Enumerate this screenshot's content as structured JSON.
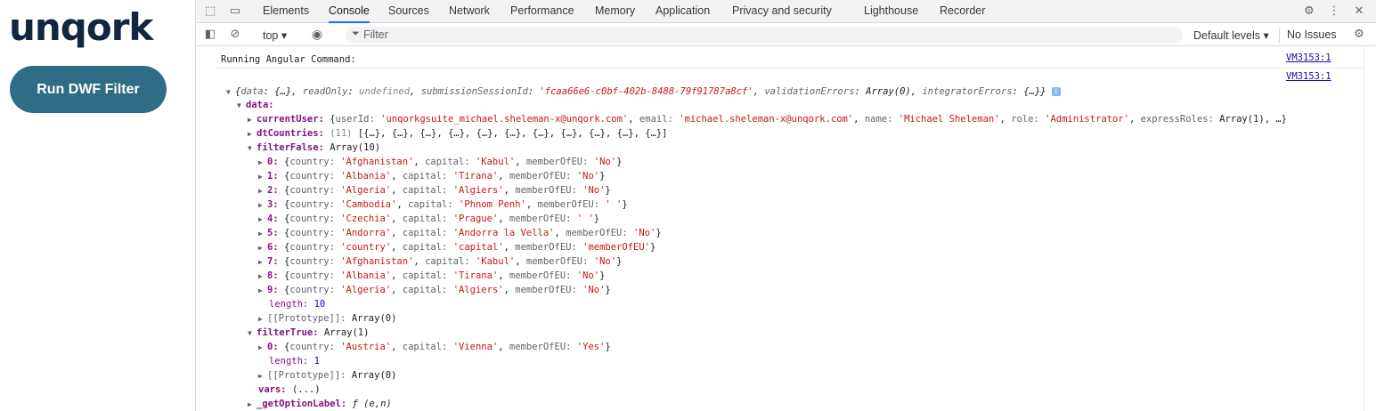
{
  "app": {
    "logo": "unqork",
    "run_button": "Run DWF Filter"
  },
  "devtools": {
    "tabs": [
      "Elements",
      "Console",
      "Sources",
      "Network",
      "Performance",
      "Memory",
      "Application",
      "Privacy and security",
      "Lighthouse",
      "Recorder"
    ],
    "active_tab": "Console",
    "context": "top ▾",
    "filter_placeholder": "Filter",
    "levels": "Default levels ▾",
    "issues": "No Issues"
  },
  "console": {
    "message": "Running Angular Command:",
    "source1": "VM3153:1",
    "source2": "VM3153:1",
    "summary": {
      "open": "{",
      "k1": "data",
      "v1": "{…}",
      "k2": "readOnly",
      "v2": "undefined",
      "k3": "submissionSessionId",
      "v3": "'fcaa66e6-c0bf-402b-8488-79f91787a8cf'",
      "k4": "validationErrors",
      "v4": "Array(0)",
      "k5": "integratorErrors",
      "v5": "{…}",
      "close": "}",
      "badge": "i"
    },
    "data_key": "data:",
    "current_user": {
      "key": "currentUser:",
      "prefix": "{",
      "userId_k": "userId:",
      "userId_v": "'unqorkgsuite_michael.sheleman-x@unqork.com'",
      "email_k": "email:",
      "email_v": "'michael.sheleman-x@unqork.com'",
      "name_k": "name:",
      "name_v": "'Michael Sheleman'",
      "role_k": "role:",
      "role_v": "'Administrator'",
      "express_k": "expressRoles:",
      "express_v": "Array(1), …}"
    },
    "dt_countries": {
      "key": "dtCountries:",
      "count": "(11)",
      "value": "[{…}, {…}, {…}, {…}, {…}, {…}, {…}, {…}, {…}, {…}, {…}]"
    },
    "filter_false": {
      "key": "filterFalse:",
      "type": "Array(10)",
      "items": [
        {
          "idx": "0:",
          "country": "'Afghanistan'",
          "capital": "'Kabul'",
          "member": "'No'"
        },
        {
          "idx": "1:",
          "country": "'Albania'",
          "capital": "'Tirana'",
          "member": "'No'"
        },
        {
          "idx": "2:",
          "country": "'Algeria'",
          "capital": "'Algiers'",
          "member": "'No'"
        },
        {
          "idx": "3:",
          "country": "'Cambodia'",
          "capital": "'Phnom Penh'",
          "member": "' '"
        },
        {
          "idx": "4:",
          "country": "'Czechia'",
          "capital": "'Prague'",
          "member": "' '"
        },
        {
          "idx": "5:",
          "country": "'Andorra'",
          "capital": "'Andorra la Vella'",
          "member": "'No'"
        },
        {
          "idx": "6:",
          "country": "'country'",
          "capital": "'capital'",
          "member": "'memberOfEU'"
        },
        {
          "idx": "7:",
          "country": "'Afghanistan'",
          "capital": "'Kabul'",
          "member": "'No'"
        },
        {
          "idx": "8:",
          "country": "'Albania'",
          "capital": "'Tirana'",
          "member": "'No'"
        },
        {
          "idx": "9:",
          "country": "'Algeria'",
          "capital": "'Algiers'",
          "member": "'No'"
        }
      ],
      "length_k": "length:",
      "length_v": "10",
      "proto_k": "[[Prototype]]:",
      "proto_v": "Array(0)"
    },
    "filter_true": {
      "key": "filterTrue:",
      "type": "Array(1)",
      "items": [
        {
          "idx": "0:",
          "country": "'Austria'",
          "capital": "'Vienna'",
          "member": "'Yes'"
        }
      ],
      "length_k": "length:",
      "length_v": "1",
      "proto_k": "[[Prototype]]:",
      "proto_v": "Array(0)"
    },
    "field_labels": {
      "country": "country:",
      "capital": "capital:",
      "member": "memberOfEU:"
    },
    "vars": {
      "key": "vars:",
      "value": "(...)"
    },
    "get_option": {
      "key": "_getOptionLabel:",
      "value": "ƒ (e,n)"
    }
  }
}
